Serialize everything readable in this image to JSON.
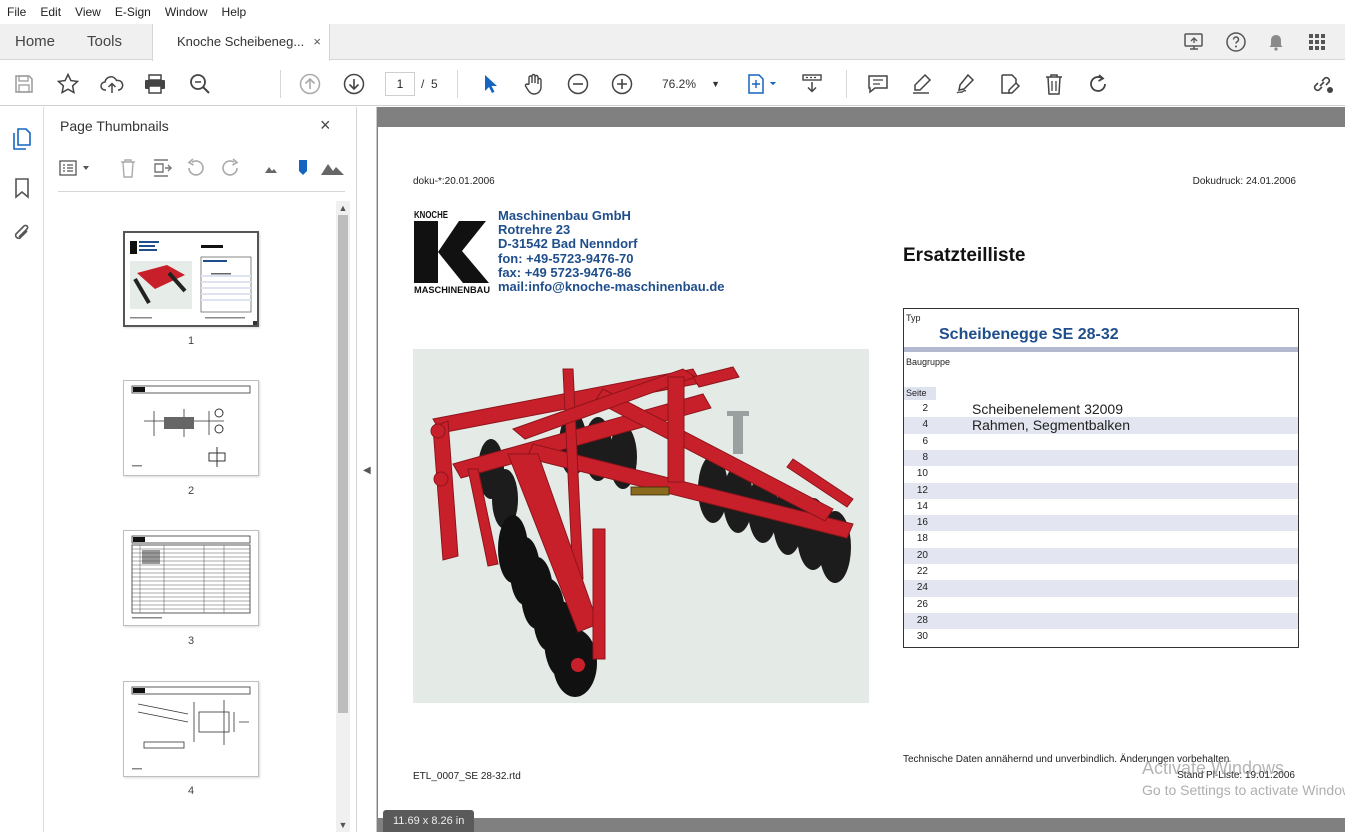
{
  "menu": [
    "File",
    "Edit",
    "View",
    "E-Sign",
    "Window",
    "Help"
  ],
  "tabs": {
    "home": "Home",
    "tools": "Tools",
    "document": "Knoche Scheibeneg...",
    "close_glyph": "×"
  },
  "toolbar": {
    "current_page": "1",
    "page_separator": "/",
    "total_pages": "5",
    "zoom": "76.2%"
  },
  "thumbnails_panel": {
    "title": "Page Thumbnails",
    "close_glyph": "×",
    "pages": [
      "1",
      "2",
      "3",
      "4"
    ]
  },
  "document": {
    "header_left": "doku-*:20.01.2006",
    "header_right": "Dokudruck: 24.01.2006",
    "logo_top": "KNOCHE",
    "logo_letter": "K",
    "logo_bottom": "MASCHINENBAU",
    "company": {
      "name": "Maschinenbau GmbH",
      "street": "Rotrehre 23",
      "city": "D-31542 Bad Nenndorf",
      "phone": "fon: +49-5723-9476-70",
      "fax": "fax: +49 5723-9476-86",
      "mail": "mail:info@knoche-maschinenbau.de"
    },
    "title": "Ersatzteilliste",
    "parts_table": {
      "typ_label": "Typ",
      "model": "Scheibenegge SE 28-32",
      "baugruppe_label": "Baugruppe",
      "seite_label": "Seite",
      "rows": [
        {
          "page": "2",
          "name": "Scheibenelement 32009"
        },
        {
          "page": "4",
          "name": "Rahmen, Segmentbalken"
        },
        {
          "page": "6",
          "name": ""
        },
        {
          "page": "8",
          "name": ""
        },
        {
          "page": "10",
          "name": ""
        },
        {
          "page": "12",
          "name": ""
        },
        {
          "page": "14",
          "name": ""
        },
        {
          "page": "16",
          "name": ""
        },
        {
          "page": "18",
          "name": ""
        },
        {
          "page": "20",
          "name": ""
        },
        {
          "page": "22",
          "name": ""
        },
        {
          "page": "24",
          "name": ""
        },
        {
          "page": "26",
          "name": ""
        },
        {
          "page": "28",
          "name": ""
        },
        {
          "page": "30",
          "name": ""
        }
      ]
    },
    "footer_left": "ETL_0007_SE 28-32.rtd",
    "footer_tech": "Technische Daten annähernd und unverbindlich. Änderungen vorbehalten",
    "footer_stand": "Stand Pl-Liste: 19.01.2006",
    "page_size": "11.69 x 8.26 in"
  },
  "watermark": {
    "line1": "Activate Windows",
    "line2": "Go to Settings to activate Windows."
  },
  "colors": {
    "accent_blue": "#1f4e8c",
    "machine_red": "#c8202a",
    "table_shade": "#e3e5f0",
    "doc_background": "#808080"
  }
}
